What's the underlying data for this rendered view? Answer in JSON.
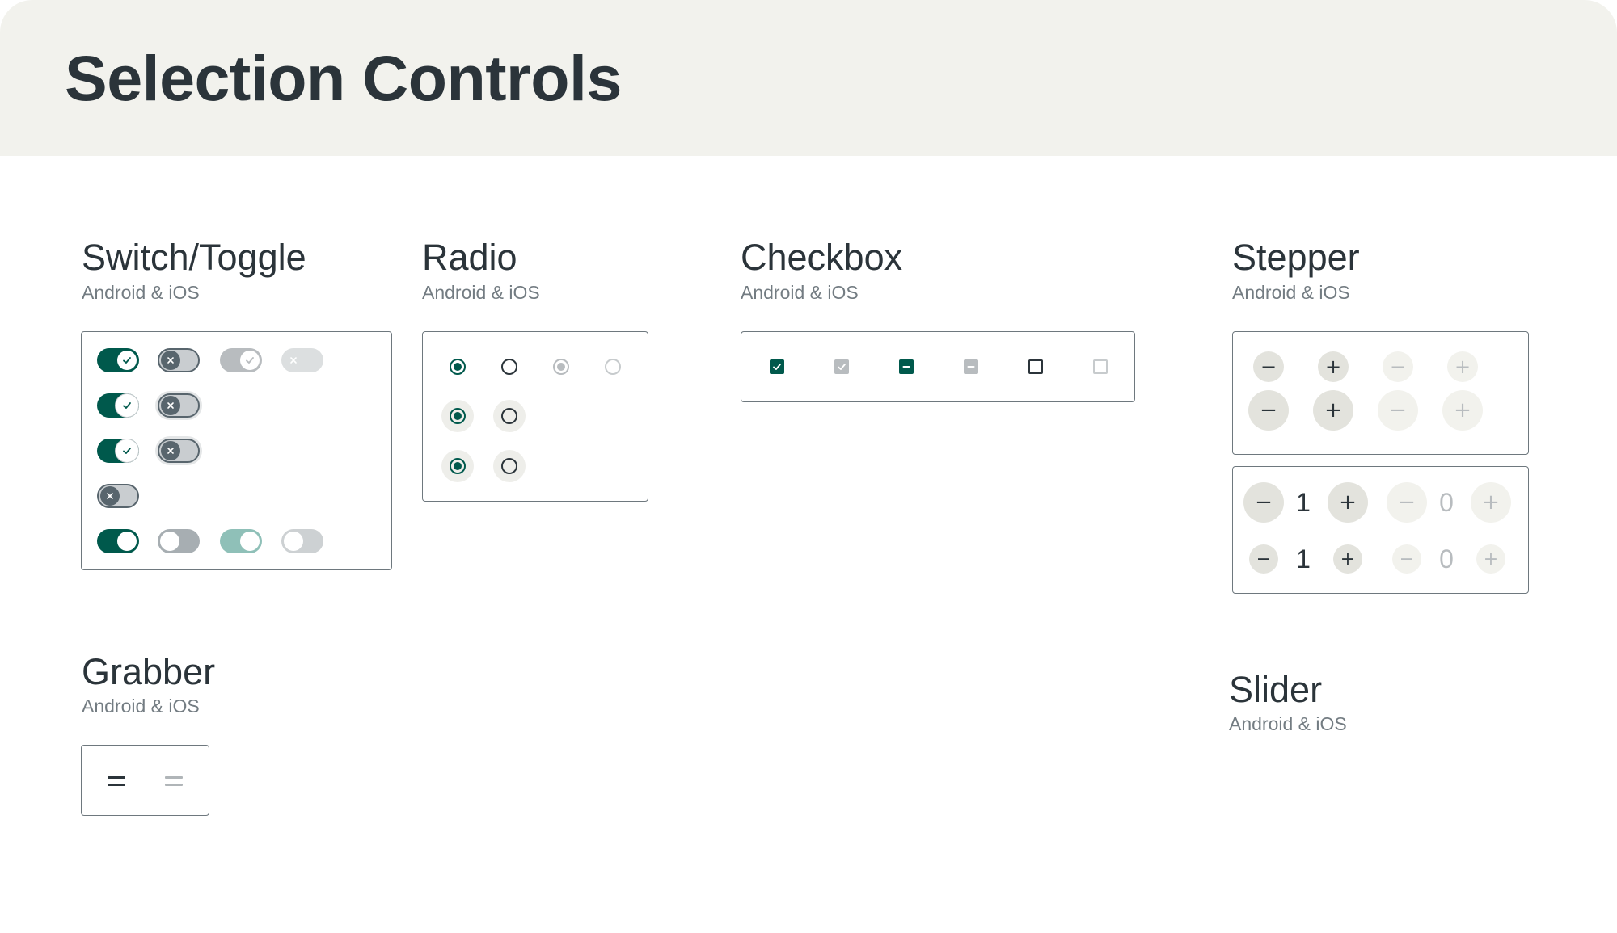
{
  "header": {
    "title": "Selection Controls"
  },
  "sections": {
    "switch": {
      "title": "Switch/Toggle",
      "subtitle": "Android & iOS"
    },
    "radio": {
      "title": "Radio",
      "subtitle": "Android & iOS"
    },
    "checkbox": {
      "title": "Checkbox",
      "subtitle": "Android & iOS"
    },
    "stepper": {
      "title": "Stepper",
      "subtitle": "Android & iOS"
    },
    "grabber": {
      "title": "Grabber",
      "subtitle": "Android & iOS"
    },
    "slider": {
      "title": "Slider",
      "subtitle": "Android & iOS"
    }
  },
  "stepper": {
    "minus": "−",
    "plus": "+",
    "enabled_value": "1",
    "disabled_value": "0"
  },
  "colors": {
    "brand": "#00594c",
    "text": "#2b343a",
    "header_bg": "#f2f2ed",
    "disabled": "#b8bcbf"
  },
  "icons": [
    "check-icon",
    "close-icon",
    "minus-icon",
    "plus-icon",
    "grabber-icon"
  ]
}
